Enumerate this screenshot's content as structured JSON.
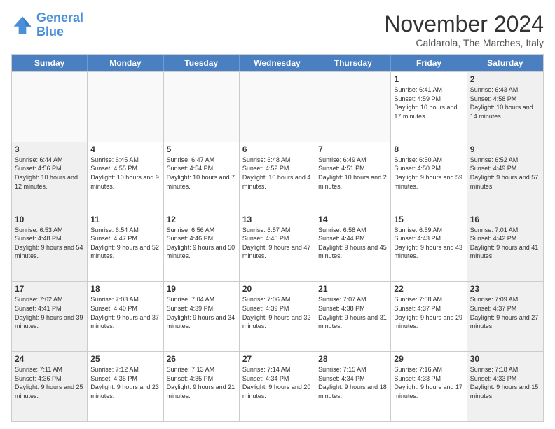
{
  "header": {
    "logo_line1": "General",
    "logo_line2": "Blue",
    "month_title": "November 2024",
    "location": "Caldarola, The Marches, Italy"
  },
  "weekdays": [
    "Sunday",
    "Monday",
    "Tuesday",
    "Wednesday",
    "Thursday",
    "Friday",
    "Saturday"
  ],
  "weeks": [
    [
      {
        "day": "",
        "info": ""
      },
      {
        "day": "",
        "info": ""
      },
      {
        "day": "",
        "info": ""
      },
      {
        "day": "",
        "info": ""
      },
      {
        "day": "",
        "info": ""
      },
      {
        "day": "1",
        "info": "Sunrise: 6:41 AM\nSunset: 4:59 PM\nDaylight: 10 hours and 17 minutes."
      },
      {
        "day": "2",
        "info": "Sunrise: 6:43 AM\nSunset: 4:58 PM\nDaylight: 10 hours and 14 minutes."
      }
    ],
    [
      {
        "day": "3",
        "info": "Sunrise: 6:44 AM\nSunset: 4:56 PM\nDaylight: 10 hours and 12 minutes."
      },
      {
        "day": "4",
        "info": "Sunrise: 6:45 AM\nSunset: 4:55 PM\nDaylight: 10 hours and 9 minutes."
      },
      {
        "day": "5",
        "info": "Sunrise: 6:47 AM\nSunset: 4:54 PM\nDaylight: 10 hours and 7 minutes."
      },
      {
        "day": "6",
        "info": "Sunrise: 6:48 AM\nSunset: 4:52 PM\nDaylight: 10 hours and 4 minutes."
      },
      {
        "day": "7",
        "info": "Sunrise: 6:49 AM\nSunset: 4:51 PM\nDaylight: 10 hours and 2 minutes."
      },
      {
        "day": "8",
        "info": "Sunrise: 6:50 AM\nSunset: 4:50 PM\nDaylight: 9 hours and 59 minutes."
      },
      {
        "day": "9",
        "info": "Sunrise: 6:52 AM\nSunset: 4:49 PM\nDaylight: 9 hours and 57 minutes."
      }
    ],
    [
      {
        "day": "10",
        "info": "Sunrise: 6:53 AM\nSunset: 4:48 PM\nDaylight: 9 hours and 54 minutes."
      },
      {
        "day": "11",
        "info": "Sunrise: 6:54 AM\nSunset: 4:47 PM\nDaylight: 9 hours and 52 minutes."
      },
      {
        "day": "12",
        "info": "Sunrise: 6:56 AM\nSunset: 4:46 PM\nDaylight: 9 hours and 50 minutes."
      },
      {
        "day": "13",
        "info": "Sunrise: 6:57 AM\nSunset: 4:45 PM\nDaylight: 9 hours and 47 minutes."
      },
      {
        "day": "14",
        "info": "Sunrise: 6:58 AM\nSunset: 4:44 PM\nDaylight: 9 hours and 45 minutes."
      },
      {
        "day": "15",
        "info": "Sunrise: 6:59 AM\nSunset: 4:43 PM\nDaylight: 9 hours and 43 minutes."
      },
      {
        "day": "16",
        "info": "Sunrise: 7:01 AM\nSunset: 4:42 PM\nDaylight: 9 hours and 41 minutes."
      }
    ],
    [
      {
        "day": "17",
        "info": "Sunrise: 7:02 AM\nSunset: 4:41 PM\nDaylight: 9 hours and 39 minutes."
      },
      {
        "day": "18",
        "info": "Sunrise: 7:03 AM\nSunset: 4:40 PM\nDaylight: 9 hours and 37 minutes."
      },
      {
        "day": "19",
        "info": "Sunrise: 7:04 AM\nSunset: 4:39 PM\nDaylight: 9 hours and 34 minutes."
      },
      {
        "day": "20",
        "info": "Sunrise: 7:06 AM\nSunset: 4:39 PM\nDaylight: 9 hours and 32 minutes."
      },
      {
        "day": "21",
        "info": "Sunrise: 7:07 AM\nSunset: 4:38 PM\nDaylight: 9 hours and 31 minutes."
      },
      {
        "day": "22",
        "info": "Sunrise: 7:08 AM\nSunset: 4:37 PM\nDaylight: 9 hours and 29 minutes."
      },
      {
        "day": "23",
        "info": "Sunrise: 7:09 AM\nSunset: 4:37 PM\nDaylight: 9 hours and 27 minutes."
      }
    ],
    [
      {
        "day": "24",
        "info": "Sunrise: 7:11 AM\nSunset: 4:36 PM\nDaylight: 9 hours and 25 minutes."
      },
      {
        "day": "25",
        "info": "Sunrise: 7:12 AM\nSunset: 4:35 PM\nDaylight: 9 hours and 23 minutes."
      },
      {
        "day": "26",
        "info": "Sunrise: 7:13 AM\nSunset: 4:35 PM\nDaylight: 9 hours and 21 minutes."
      },
      {
        "day": "27",
        "info": "Sunrise: 7:14 AM\nSunset: 4:34 PM\nDaylight: 9 hours and 20 minutes."
      },
      {
        "day": "28",
        "info": "Sunrise: 7:15 AM\nSunset: 4:34 PM\nDaylight: 9 hours and 18 minutes."
      },
      {
        "day": "29",
        "info": "Sunrise: 7:16 AM\nSunset: 4:33 PM\nDaylight: 9 hours and 17 minutes."
      },
      {
        "day": "30",
        "info": "Sunrise: 7:18 AM\nSunset: 4:33 PM\nDaylight: 9 hours and 15 minutes."
      }
    ]
  ]
}
